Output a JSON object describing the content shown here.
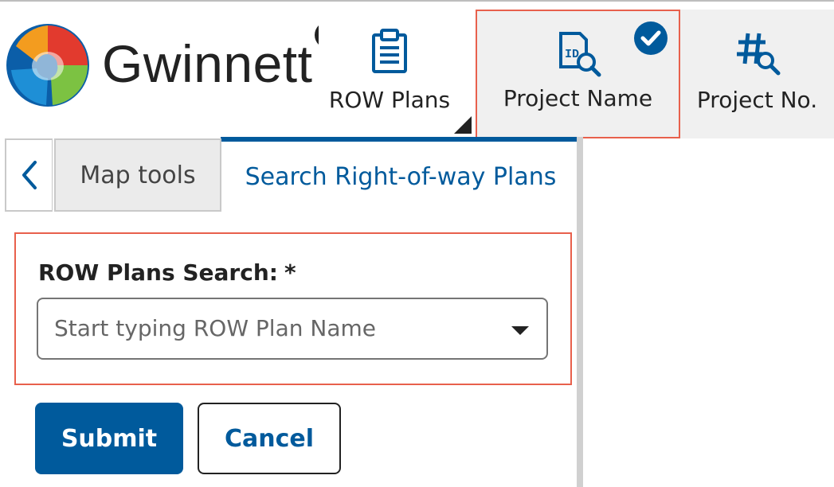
{
  "brand": {
    "name": "Gwinnett",
    "logo_icon": "gwinnett-logo-icon",
    "colors": {
      "red": "#e23a2e",
      "orange": "#f39c1f",
      "green": "#7cc242",
      "blue": "#1e8fd6",
      "navy": "#0b5ea8"
    }
  },
  "toolbar": {
    "close_icon": "close-circle-icon",
    "buttons": [
      {
        "label": "ROW Plans",
        "icon": "clipboard-icon",
        "selected": false
      },
      {
        "label": "Project Name",
        "icon": "id-search-icon",
        "selected": true
      },
      {
        "label": "Project No.",
        "icon": "hash-search-icon",
        "selected": false
      }
    ]
  },
  "panel": {
    "back_icon": "chevron-left-icon",
    "tabs": [
      {
        "label": "Map tools",
        "active": false
      },
      {
        "label": "Search Right-of-way Plans",
        "active": true
      }
    ],
    "form": {
      "label": "ROW Plans Search:",
      "required_marker": "*",
      "select": {
        "placeholder": "Start typing ROW Plan Name",
        "value": ""
      }
    },
    "submit_label": "Submit",
    "cancel_label": "Cancel"
  },
  "colors": {
    "accent": "#005a9c",
    "highlight_border": "#e8604c",
    "toolbar_bg": "#f0f0f0"
  }
}
